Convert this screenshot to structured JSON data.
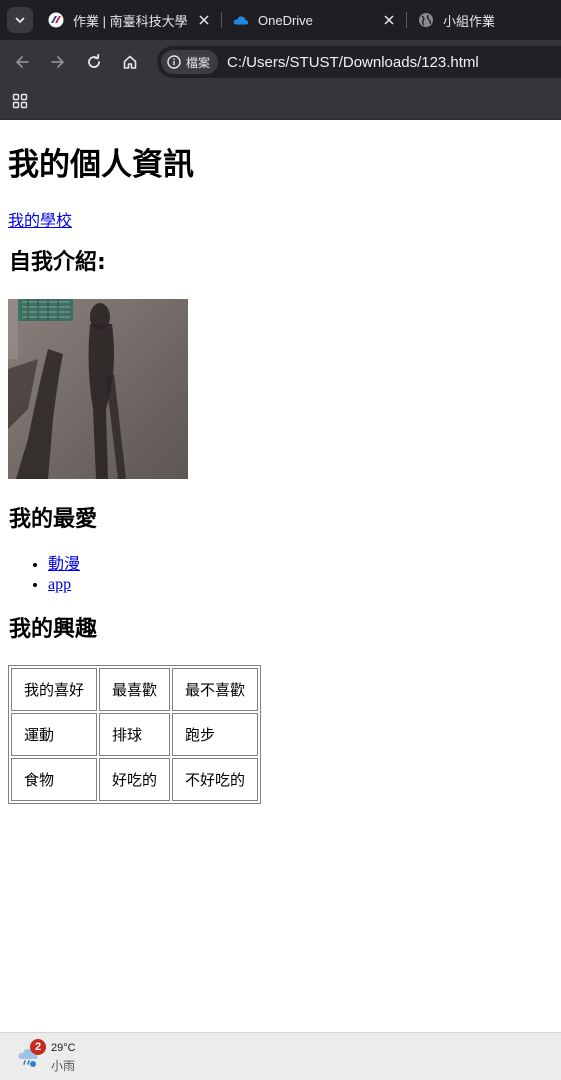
{
  "browser": {
    "tabs": [
      {
        "title": "作業 | 南臺科技大學 F",
        "icon": "school-favicon",
        "active": false
      },
      {
        "title": "OneDrive",
        "icon": "onedrive-cloud-icon",
        "active": false
      },
      {
        "title": "小組作業",
        "icon": "globe-icon",
        "active": false
      }
    ],
    "chip_label": "檔案",
    "url": "C:/Users/STUST/Downloads/123.html"
  },
  "page": {
    "title": "我的個人資訊",
    "school_link": "我的學校",
    "intro_heading": "自我介紹:",
    "favorites_heading": "我的最愛",
    "favorites": [
      "動漫",
      "app"
    ],
    "hobby_heading": "我的興趣",
    "hobby_table": [
      [
        "我的喜好",
        "最喜歡",
        "最不喜歡"
      ],
      [
        "運動",
        "排球",
        "跑步"
      ],
      [
        "食物",
        "好吃的",
        "不好吃的"
      ]
    ]
  },
  "taskbar": {
    "badge_count": "2",
    "temperature": "29°C",
    "condition": "小雨"
  }
}
